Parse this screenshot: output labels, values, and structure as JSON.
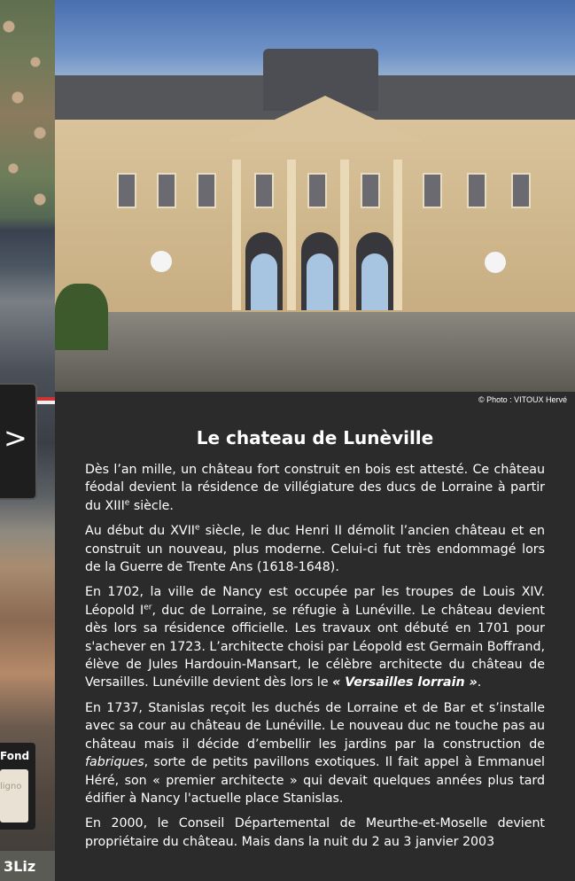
{
  "map_panel": {
    "nav_chevron": ">",
    "fond_label": "Fond",
    "fond_thumb_text": "ligno",
    "logo_text": "3Liz"
  },
  "photo": {
    "credit": "© Photo : VITOUX Hervé"
  },
  "article": {
    "title": "Le chateau de Lunèville",
    "p1": {
      "text": "Dès l’an mille, un château fort construit en bois est attesté. Ce château féodal devient la résidence de villégiature des ducs de Lorraine à partir du XIII",
      "sup": "e",
      "end": " siècle."
    },
    "p2": {
      "a": "Au début du XVII",
      "sup": "e",
      "b": " siècle, le duc Henri II démolit l’ancien château et en construit un nouveau, plus moderne. Celui-ci fut très endommagé lors de la Guerre de Trente Ans (1618-1648)."
    },
    "p3": {
      "a": "En 1702, la ville de Nancy est occupée par les troupes de Louis XIV. Léopold I",
      "sup": "er",
      "b": ", duc de Lorraine, se réfugie à Lunéville. Le château devient dès lors sa résidence officielle. Les travaux ont débuté en 1701 pour s'achever en 1723. L’architecte choisi par Léopold est Germain Boffrand, élève de Jules Hardouin-Mansart, le célèbre architecte du château de Versailles. Lunéville devient dès lors le ",
      "em": "« Versailles lorrain »",
      "c": "."
    },
    "p4": {
      "a": "En 1737, Stanislas reçoit les duchés de Lorraine et de Bar et s’installe avec sa cour au château de Lunéville. Le nouveau duc ne touche pas au château mais il décide d’embellir les jardins par la construction de ",
      "em": "fabriques",
      "b": ", sorte de petits pavillons exotiques. Il fait appel à Emmanuel Héré, son « premier architecte » qui devait quelques années plus tard édifier à Nancy l'actuelle place Stanislas."
    },
    "p5": {
      "text": "En 2000, le Conseil Départemental de Meurthe-et-Moselle devient propriétaire du château. Mais dans la nuit du 2 au 3 janvier 2003"
    }
  }
}
